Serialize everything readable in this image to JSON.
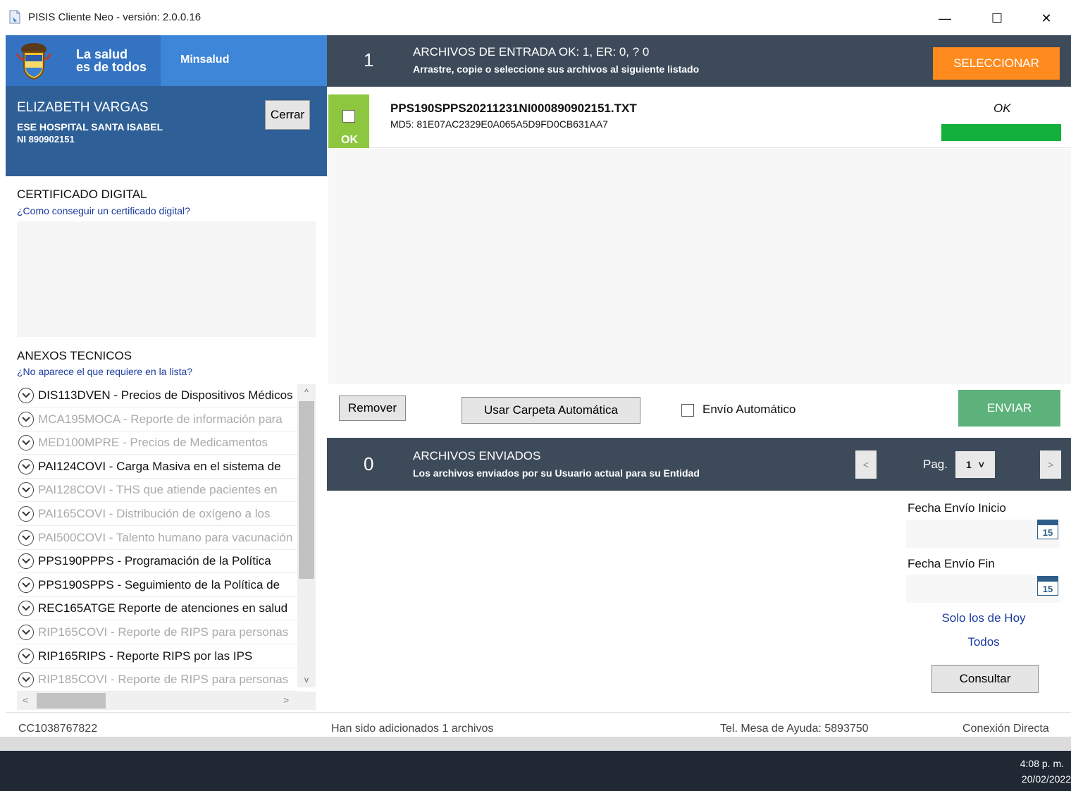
{
  "window": {
    "title": "PISIS Cliente Neo - versión: 2.0.0.16",
    "minimize": "—",
    "maximize": "☐",
    "close": "✕"
  },
  "brand": {
    "slogan_line1": "La salud",
    "slogan_line2": "es de todos",
    "ministry": "Minsalud"
  },
  "user": {
    "name": "ELIZABETH VARGAS",
    "entity": "ESE HOSPITAL SANTA ISABEL",
    "id": "NI 890902151",
    "logout_label": "Cerrar"
  },
  "certificate": {
    "title": "CERTIFICADO DIGITAL",
    "help_link": "¿Como conseguir un certificado digital?"
  },
  "annexes": {
    "title": "ANEXOS TECNICOS",
    "help_link": "¿No aparece el que requiere en la lista?",
    "items": [
      {
        "label": "DIS113DVEN - Precios de Dispositivos Médicos",
        "enabled": true
      },
      {
        "label": "MCA195MOCA - Reporte de información para",
        "enabled": false
      },
      {
        "label": "MED100MPRE - Precios de Medicamentos",
        "enabled": false
      },
      {
        "label": "PAI124COVI - Carga Masiva en el sistema de",
        "enabled": true
      },
      {
        "label": "PAI128COVI - THS que atiende pacientes en",
        "enabled": false
      },
      {
        "label": "PAI165COVI - Distribución de oxígeno a los",
        "enabled": false
      },
      {
        "label": "PAI500COVI - Talento humano para vacunación",
        "enabled": false
      },
      {
        "label": "PPS190PPPS - Programación de la Política",
        "enabled": true
      },
      {
        "label": "PPS190SPPS - Seguimiento de la Política de",
        "enabled": true
      },
      {
        "label": "REC165ATGE Reporte de atenciones en salud",
        "enabled": true
      },
      {
        "label": "RIP165COVI - Reporte de RIPS para personas",
        "enabled": false
      },
      {
        "label": "RIP165RIPS - Reporte RIPS por las IPS",
        "enabled": true
      },
      {
        "label": "RIP185COVI - Reporte de RIPS para personas",
        "enabled": false
      }
    ]
  },
  "input": {
    "count": "1",
    "title": "ARCHIVOS DE ENTRADA  OK: 1, ER: 0, ? 0",
    "subtitle": "Arrastre, copie o seleccione sus archivos al siguiente listado",
    "select_label": "SELECCIONAR",
    "files": [
      {
        "name": "PPS190SPPS20211231NI000890902151.TXT",
        "md5": "MD5: 81E07AC2329E0A065A5D9FD0CB631AA7",
        "badge": "OK",
        "status": "OK",
        "progress": 1.0
      }
    ]
  },
  "actions": {
    "remove_label": "Remover",
    "auto_folder_label": "Usar Carpeta Automática",
    "auto_send_label": "Envío Automático",
    "send_label": "ENVIAR"
  },
  "output": {
    "count": "0",
    "title": "ARCHIVOS ENVIADOS",
    "subtitle": "Los archivos enviados por su Usuario actual para su Entidad",
    "prev": "<",
    "next": ">",
    "page_label": "Pag.",
    "page_value": "1",
    "page_caret": "˅"
  },
  "filters": {
    "start_label": "Fecha Envío Inicio",
    "end_label": "Fecha Envío Fin",
    "calendar_day": "15",
    "today_link": "Solo los de Hoy",
    "all_link": "Todos",
    "query_label": "Consultar"
  },
  "status": {
    "user_doc": "CC1038767822",
    "message": "Han sido adicionados 1 archivos",
    "helpdesk": "Tel. Mesa de Ayuda: 5893750",
    "connection": "Conexión Directa"
  },
  "taskbar": {
    "time": "4:08 p. m.",
    "date": "20/02/2022"
  },
  "colors": {
    "brand_blue": "#3473c2",
    "user_blue": "#2e5f96",
    "header_dark": "#3d4a5a",
    "accent_orange": "#ff8a1e",
    "ok_green": "#8dc63f",
    "progress_green": "#13b03b",
    "send_green": "#5cb27a"
  }
}
